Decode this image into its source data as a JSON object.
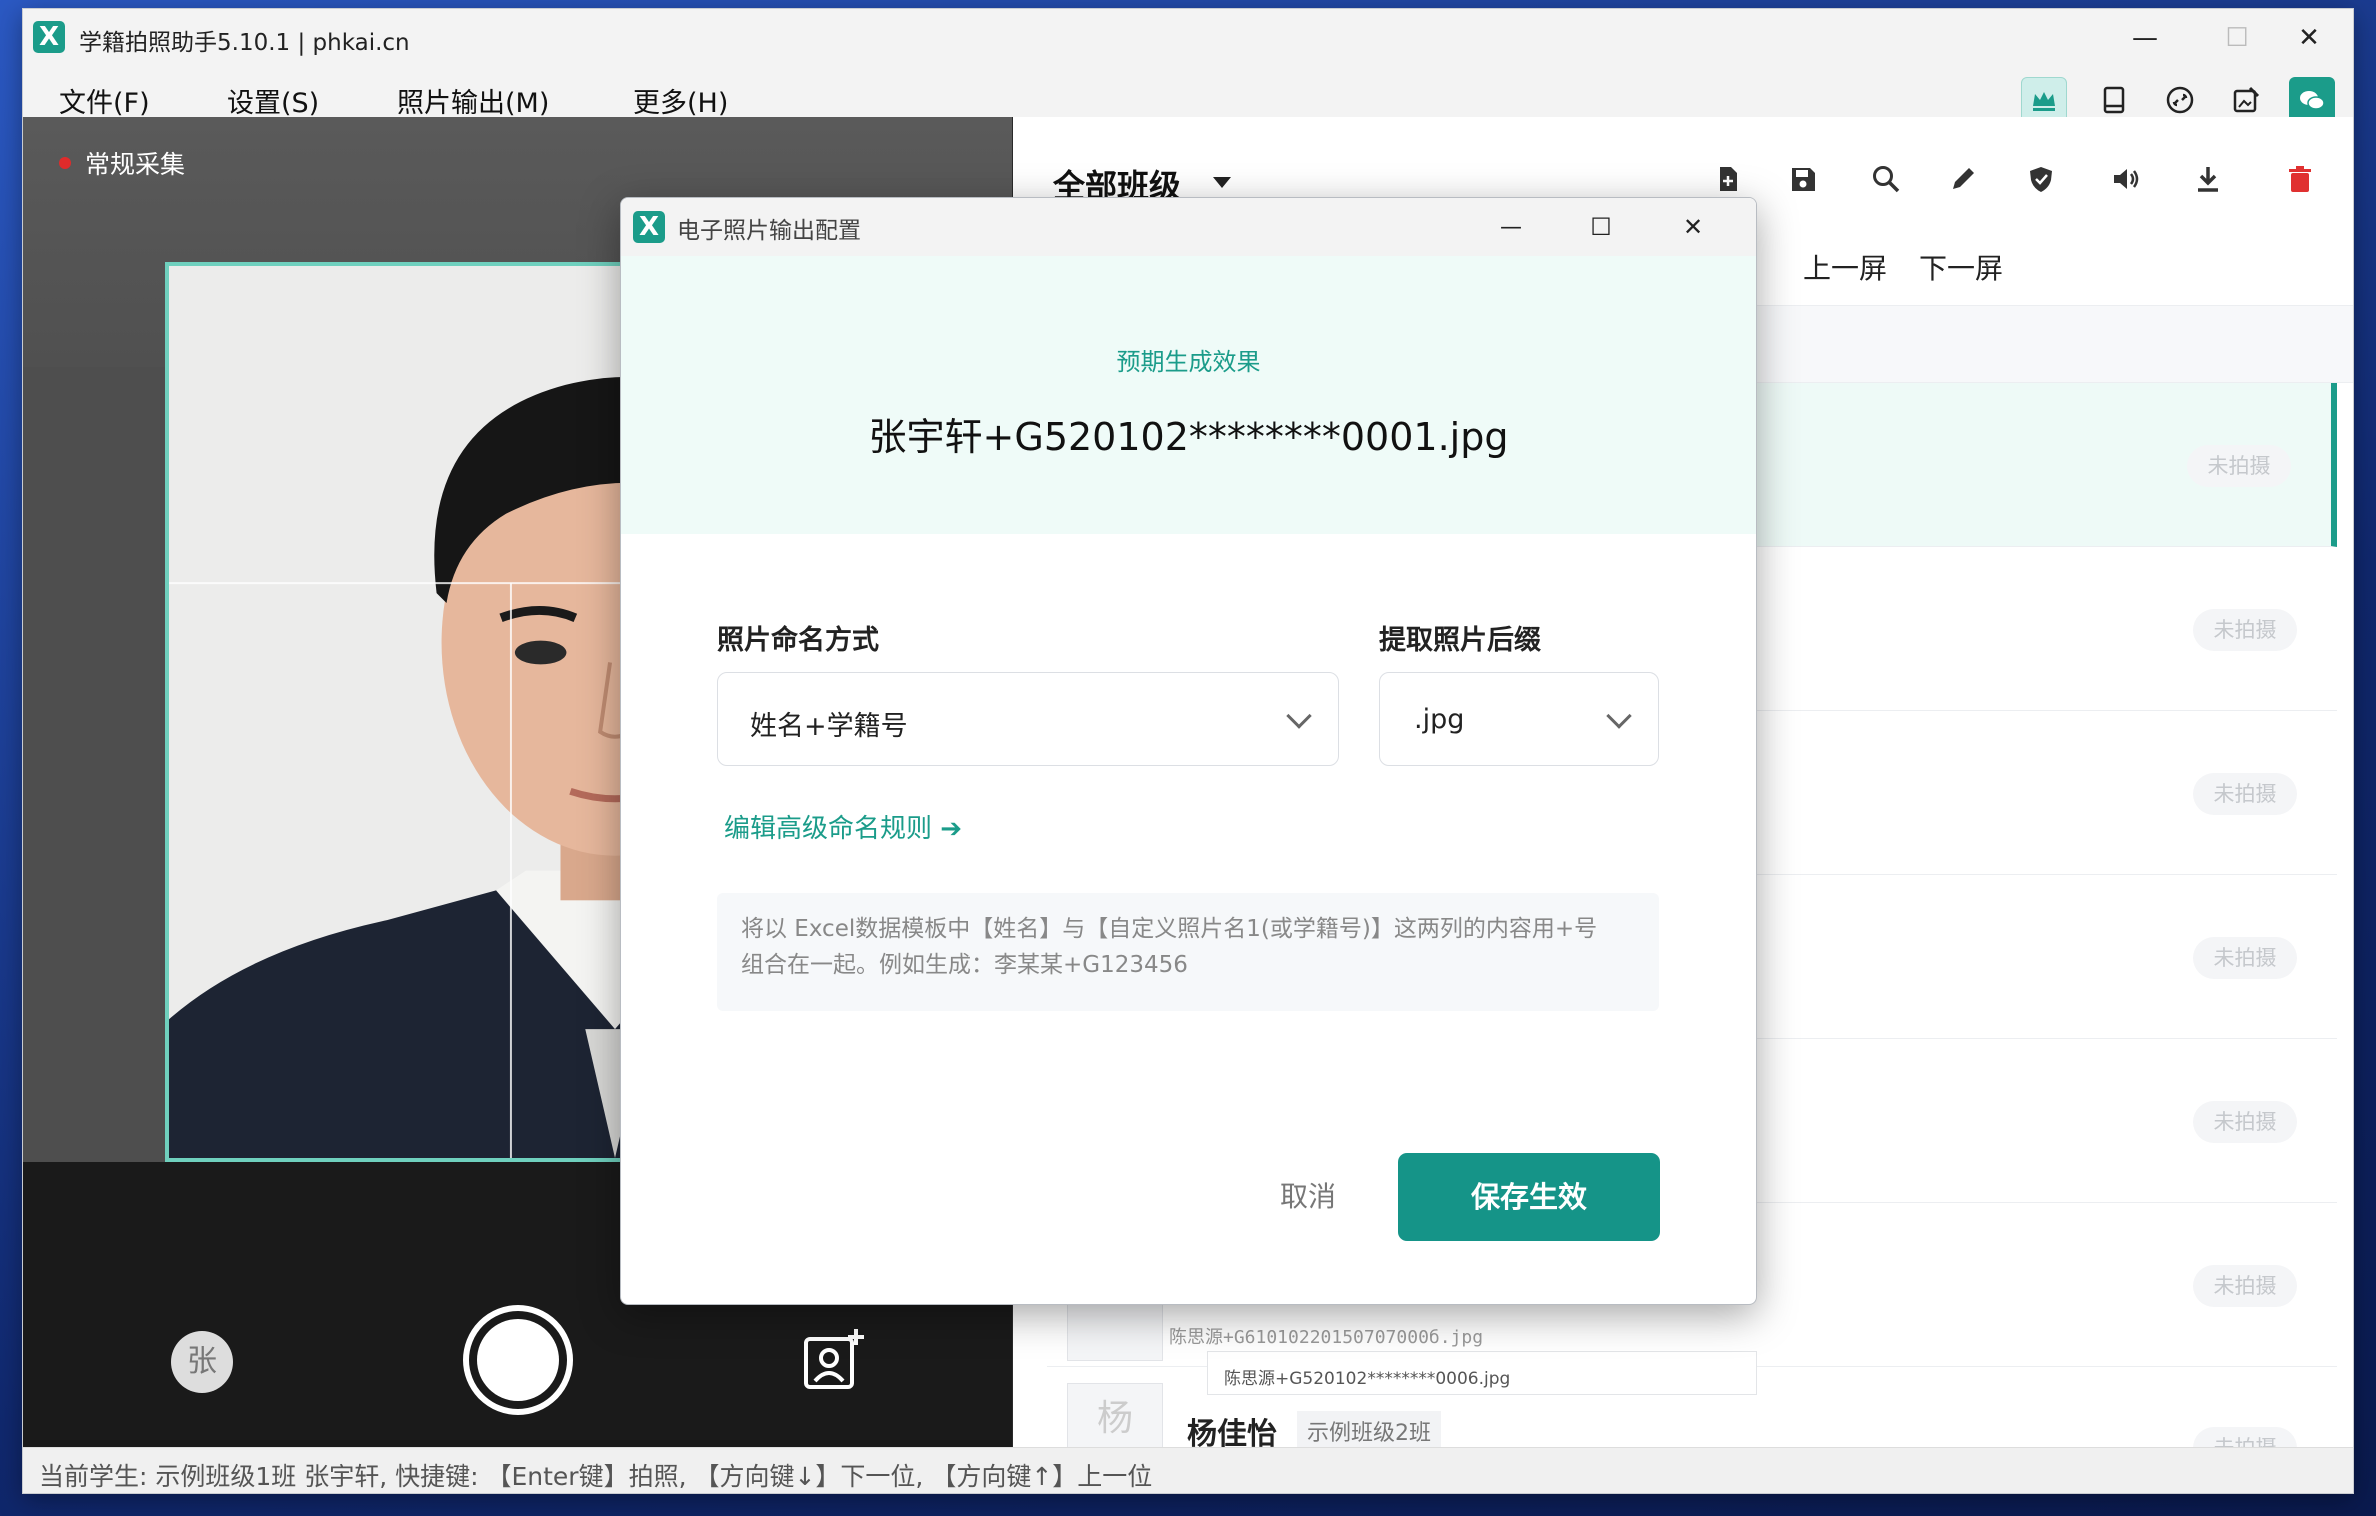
{
  "app": {
    "title": "学籍拍照助手5.10.1 | phkai.cn",
    "logo_letter": "X"
  },
  "window_controls": {
    "minimize": "—",
    "maximize": "☐",
    "close": "✕"
  },
  "menu": [
    "文件(F)",
    "设置(S)",
    "照片输出(M)",
    "更多(H)"
  ],
  "toolbar_icons": [
    "crown-icon",
    "tablet-icon",
    "link-icon",
    "edit-image-icon",
    "wechat-icon"
  ],
  "camera": {
    "mode_label": "常规采集",
    "student_initial": "张"
  },
  "right_panel": {
    "class_selector": "全部班级",
    "prev_screen": "上一屏",
    "next_screen": "下一屏",
    "toolbar_icons": [
      "new-file-icon",
      "save-icon",
      "search-icon",
      "pencil-icon",
      "shield-icon",
      "speaker-icon",
      "download-icon",
      "delete-icon"
    ],
    "badge_label": "未拍摄",
    "partial_row": {
      "filename_text": "陈思源+G61010220150707000б.jpg",
      "filename_box": "陈思源+G520102********0006.jpg"
    },
    "last_row": {
      "name": "杨佳怡",
      "class": "示例班级2班",
      "thumb_initial": "杨"
    }
  },
  "status": "当前学生: 示例班级1班 张宇轩, 快捷键: 【Enter键】拍照, 【方向键↓】下一位, 【方向键↑】上一位",
  "dialog": {
    "title": "电子照片输出配置",
    "preview_label": "预期生成效果",
    "preview_filename": "张宇轩+G520102********0001.jpg",
    "naming_label": "照片命名方式",
    "naming_value": "姓名+学籍号",
    "suffix_label": "提取照片后缀",
    "suffix_value": ".jpg",
    "advanced_link": "编辑高级命名规则 ➔",
    "hint_line1": "将以 Excel数据模板中【姓名】与【自定义照片名1(或学籍号)】这两列的内容用+号",
    "hint_line2": "组合在一起。例如生成：李某某+G123456",
    "cancel": "取消",
    "save": "保存生效"
  },
  "colors": {
    "accent": "#1b9c8a",
    "primary_button": "#159488",
    "delete": "#e03131",
    "frame": "#6fd0be"
  }
}
